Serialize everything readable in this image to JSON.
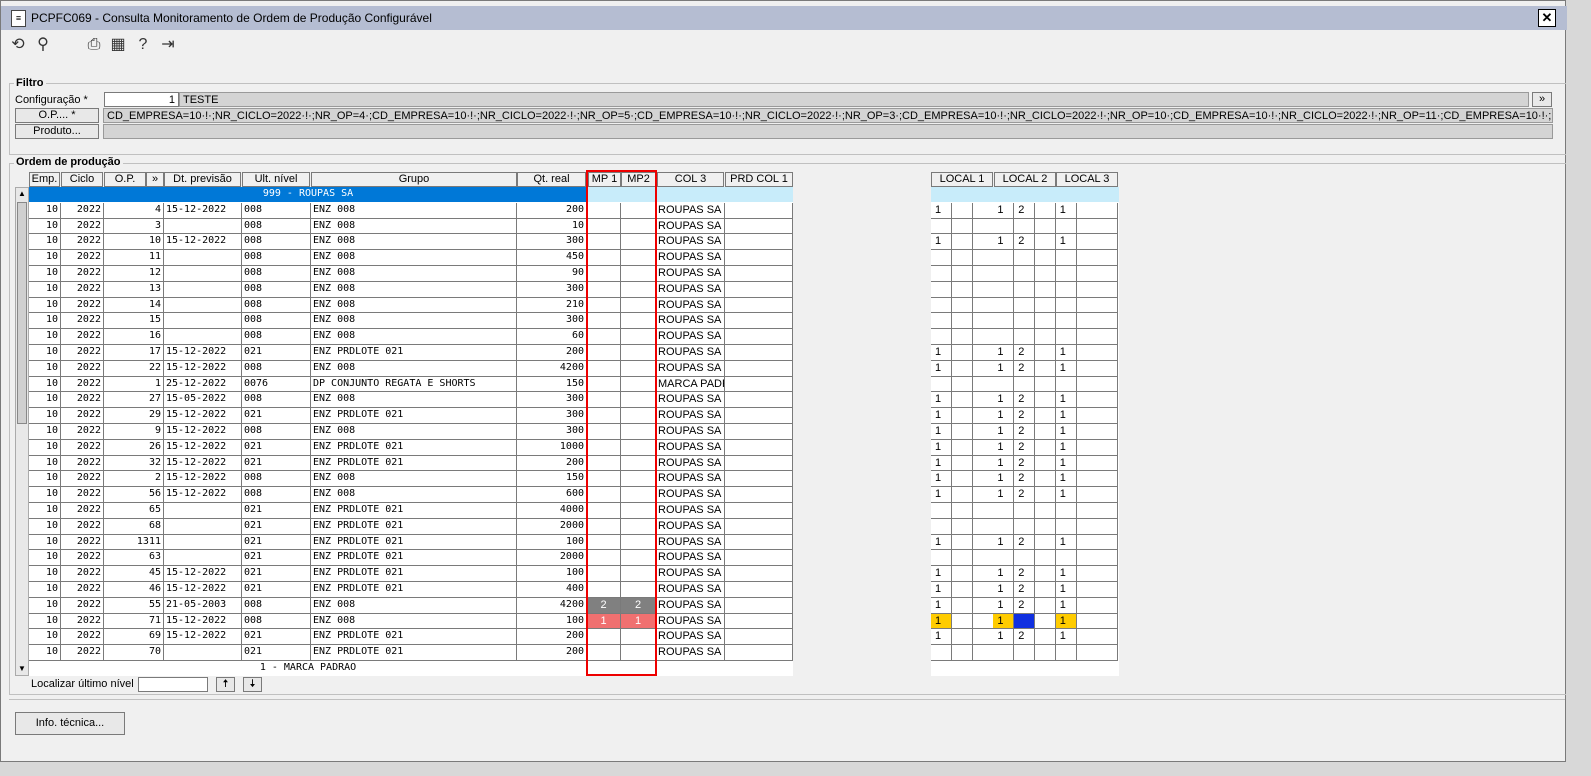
{
  "window": {
    "title": "PCPFC069 - Consulta Monitoramento de Ordem de Produção Configurável",
    "close": "✕"
  },
  "toolbar": [
    {
      "name": "refresh-icon",
      "glyph": "⟲"
    },
    {
      "name": "search-icon",
      "glyph": "⚲"
    },
    {
      "name": "print-icon",
      "glyph": "⎙"
    },
    {
      "name": "calendar-icon",
      "glyph": "▦"
    },
    {
      "name": "help-icon",
      "glyph": "?"
    },
    {
      "name": "exit-icon",
      "glyph": "⇥"
    }
  ],
  "filtro": {
    "legend": "Filtro",
    "config_label": "Configuração *",
    "config_code": "1",
    "config_name": "TESTE",
    "expand": "»",
    "op_button": "O.P.... *",
    "op_value": "CD_EMPRESA=10·!·;NR_CICLO=2022·!·;NR_OP=4·;CD_EMPRESA=10·!·;NR_CICLO=2022·!·;NR_OP=5·;CD_EMPRESA=10·!·;NR_CICLO=2022·!·;NR_OP=3·;CD_EMPRESA=10·!·;NR_CICLO=2022·!·;NR_OP=10·;CD_EMPRESA=10·!·;NR_CICLO=2022·!·;NR_OP=11·;CD_EMPRESA=10·!·;NR_CICLO=2022·!·;NR_OP=",
    "produto_button": "Produto..."
  },
  "ordem": {
    "legend": "Ordem de produção",
    "columns": [
      "Emp.",
      "Ciclo",
      "O.P.",
      "»",
      "Dt. previsão",
      "Ult. nível",
      "Grupo",
      "Qt. real",
      "MP 1",
      "MP2",
      "COL 3",
      "PRD COL 1"
    ],
    "local_columns": [
      "LOCAL 1",
      "LOCAL 2",
      "LOCAL 3"
    ],
    "group_header": "999 - ROUPAS SA",
    "group_footer": "1 - MARCA PADRAO",
    "rows": [
      {
        "emp": "10",
        "ciclo": "2022",
        "op": "4",
        "dt": "15-12-2022",
        "nivel": "008",
        "grupo": "ENZ 008",
        "qt": "200",
        "mp1": "",
        "mp2": "",
        "col3": "ROUPAS SA",
        "locais": [
          "1",
          "",
          "",
          "1",
          "2",
          "",
          "1",
          "",
          ""
        ]
      },
      {
        "emp": "10",
        "ciclo": "2022",
        "op": "3",
        "dt": "",
        "nivel": "008",
        "grupo": "ENZ 008",
        "qt": "10",
        "mp1": "",
        "mp2": "",
        "col3": "ROUPAS SA",
        "locais": [
          "",
          "",
          "",
          "",
          "",
          "",
          "",
          "",
          ""
        ]
      },
      {
        "emp": "10",
        "ciclo": "2022",
        "op": "10",
        "dt": "15-12-2022",
        "nivel": "008",
        "grupo": "ENZ 008",
        "qt": "300",
        "mp1": "",
        "mp2": "",
        "col3": "ROUPAS SA",
        "locais": [
          "1",
          "",
          "",
          "1",
          "2",
          "",
          "1",
          "",
          ""
        ]
      },
      {
        "emp": "10",
        "ciclo": "2022",
        "op": "11",
        "dt": "",
        "nivel": "008",
        "grupo": "ENZ 008",
        "qt": "450",
        "mp1": "",
        "mp2": "",
        "col3": "ROUPAS SA",
        "locais": [
          "",
          "",
          "",
          "",
          "",
          "",
          "",
          "",
          ""
        ]
      },
      {
        "emp": "10",
        "ciclo": "2022",
        "op": "12",
        "dt": "",
        "nivel": "008",
        "grupo": "ENZ 008",
        "qt": "90",
        "mp1": "",
        "mp2": "",
        "col3": "ROUPAS SA",
        "locais": [
          "",
          "",
          "",
          "",
          "",
          "",
          "",
          "",
          ""
        ]
      },
      {
        "emp": "10",
        "ciclo": "2022",
        "op": "13",
        "dt": "",
        "nivel": "008",
        "grupo": "ENZ 008",
        "qt": "300",
        "mp1": "",
        "mp2": "",
        "col3": "ROUPAS SA",
        "locais": [
          "",
          "",
          "",
          "",
          "",
          "",
          "",
          "",
          ""
        ]
      },
      {
        "emp": "10",
        "ciclo": "2022",
        "op": "14",
        "dt": "",
        "nivel": "008",
        "grupo": "ENZ 008",
        "qt": "210",
        "mp1": "",
        "mp2": "",
        "col3": "ROUPAS SA",
        "locais": [
          "",
          "",
          "",
          "",
          "",
          "",
          "",
          "",
          ""
        ]
      },
      {
        "emp": "10",
        "ciclo": "2022",
        "op": "15",
        "dt": "",
        "nivel": "008",
        "grupo": "ENZ 008",
        "qt": "300",
        "mp1": "",
        "mp2": "",
        "col3": "ROUPAS SA",
        "locais": [
          "",
          "",
          "",
          "",
          "",
          "",
          "",
          "",
          ""
        ]
      },
      {
        "emp": "10",
        "ciclo": "2022",
        "op": "16",
        "dt": "",
        "nivel": "008",
        "grupo": "ENZ 008",
        "qt": "60",
        "mp1": "",
        "mp2": "",
        "col3": "ROUPAS SA",
        "locais": [
          "",
          "",
          "",
          "",
          "",
          "",
          "",
          "",
          ""
        ]
      },
      {
        "emp": "10",
        "ciclo": "2022",
        "op": "17",
        "dt": "15-12-2022",
        "nivel": "021",
        "grupo": "ENZ PRDLOTE 021",
        "qt": "200",
        "mp1": "",
        "mp2": "",
        "col3": "ROUPAS SA",
        "locais": [
          "1",
          "",
          "",
          "1",
          "2",
          "",
          "1",
          "",
          ""
        ]
      },
      {
        "emp": "10",
        "ciclo": "2022",
        "op": "22",
        "dt": "15-12-2022",
        "nivel": "008",
        "grupo": "ENZ 008",
        "qt": "4200",
        "mp1": "",
        "mp2": "",
        "col3": "ROUPAS SA",
        "locais": [
          "1",
          "",
          "",
          "1",
          "2",
          "",
          "1",
          "",
          ""
        ]
      },
      {
        "emp": "10",
        "ciclo": "2022",
        "op": "1",
        "dt": "25-12-2022",
        "nivel": "0076",
        "grupo": "DP CONJUNTO REGATA E SHORTS",
        "qt": "150",
        "mp1": "",
        "mp2": "",
        "col3": "MARCA PADR",
        "locais": [
          "",
          "",
          "",
          "",
          "",
          "",
          "",
          "",
          ""
        ]
      },
      {
        "emp": "10",
        "ciclo": "2022",
        "op": "27",
        "dt": "15-05-2022",
        "nivel": "008",
        "grupo": "ENZ 008",
        "qt": "300",
        "mp1": "",
        "mp2": "",
        "col3": "ROUPAS SA",
        "locais": [
          "1",
          "",
          "",
          "1",
          "2",
          "",
          "1",
          "",
          ""
        ]
      },
      {
        "emp": "10",
        "ciclo": "2022",
        "op": "29",
        "dt": "15-12-2022",
        "nivel": "021",
        "grupo": "ENZ PRDLOTE 021",
        "qt": "300",
        "mp1": "",
        "mp2": "",
        "col3": "ROUPAS SA",
        "locais": [
          "1",
          "",
          "",
          "1",
          "2",
          "",
          "1",
          "",
          ""
        ]
      },
      {
        "emp": "10",
        "ciclo": "2022",
        "op": "9",
        "dt": "15-12-2022",
        "nivel": "008",
        "grupo": "ENZ 008",
        "qt": "300",
        "mp1": "",
        "mp2": "",
        "col3": "ROUPAS SA",
        "locais": [
          "1",
          "",
          "",
          "1",
          "2",
          "",
          "1",
          "",
          ""
        ]
      },
      {
        "emp": "10",
        "ciclo": "2022",
        "op": "26",
        "dt": "15-12-2022",
        "nivel": "021",
        "grupo": "ENZ PRDLOTE 021",
        "qt": "1000",
        "mp1": "",
        "mp2": "",
        "col3": "ROUPAS SA",
        "locais": [
          "1",
          "",
          "",
          "1",
          "2",
          "",
          "1",
          "",
          ""
        ]
      },
      {
        "emp": "10",
        "ciclo": "2022",
        "op": "32",
        "dt": "15-12-2022",
        "nivel": "021",
        "grupo": "ENZ PRDLOTE 021",
        "qt": "200",
        "mp1": "",
        "mp2": "",
        "col3": "ROUPAS SA",
        "locais": [
          "1",
          "",
          "",
          "1",
          "2",
          "",
          "1",
          "",
          ""
        ]
      },
      {
        "emp": "10",
        "ciclo": "2022",
        "op": "2",
        "dt": "15-12-2022",
        "nivel": "008",
        "grupo": "ENZ 008",
        "qt": "150",
        "mp1": "",
        "mp2": "",
        "col3": "ROUPAS SA",
        "locais": [
          "1",
          "",
          "",
          "1",
          "2",
          "",
          "1",
          "",
          ""
        ]
      },
      {
        "emp": "10",
        "ciclo": "2022",
        "op": "56",
        "dt": "15-12-2022",
        "nivel": "008",
        "grupo": "ENZ 008",
        "qt": "600",
        "mp1": "",
        "mp2": "",
        "col3": "ROUPAS SA",
        "locais": [
          "1",
          "",
          "",
          "1",
          "2",
          "",
          "1",
          "",
          ""
        ]
      },
      {
        "emp": "10",
        "ciclo": "2022",
        "op": "65",
        "dt": "",
        "nivel": "021",
        "grupo": "ENZ PRDLOTE 021",
        "qt": "4000",
        "mp1": "",
        "mp2": "",
        "col3": "ROUPAS SA",
        "locais": [
          "",
          "",
          "",
          "",
          "",
          "",
          "",
          "",
          ""
        ]
      },
      {
        "emp": "10",
        "ciclo": "2022",
        "op": "68",
        "dt": "",
        "nivel": "021",
        "grupo": "ENZ PRDLOTE 021",
        "qt": "2000",
        "mp1": "",
        "mp2": "",
        "col3": "ROUPAS SA",
        "locais": [
          "",
          "",
          "",
          "",
          "",
          "",
          "",
          "",
          ""
        ]
      },
      {
        "emp": "10",
        "ciclo": "2022",
        "op": "1311",
        "dt": "",
        "nivel": "021",
        "grupo": "ENZ PRDLOTE 021",
        "qt": "100",
        "mp1": "",
        "mp2": "",
        "col3": "ROUPAS SA",
        "locais": [
          "1",
          "",
          "",
          "1",
          "2",
          "",
          "1",
          "",
          ""
        ]
      },
      {
        "emp": "10",
        "ciclo": "2022",
        "op": "63",
        "dt": "",
        "nivel": "021",
        "grupo": "ENZ PRDLOTE 021",
        "qt": "2000",
        "mp1": "",
        "mp2": "",
        "col3": "ROUPAS SA",
        "locais": [
          "",
          "",
          "",
          "",
          "",
          "",
          "",
          "",
          ""
        ]
      },
      {
        "emp": "10",
        "ciclo": "2022",
        "op": "45",
        "dt": "15-12-2022",
        "nivel": "021",
        "grupo": "ENZ PRDLOTE 021",
        "qt": "100",
        "mp1": "",
        "mp2": "",
        "col3": "ROUPAS SA",
        "locais": [
          "1",
          "",
          "",
          "1",
          "2",
          "",
          "1",
          "",
          ""
        ]
      },
      {
        "emp": "10",
        "ciclo": "2022",
        "op": "46",
        "dt": "15-12-2022",
        "nivel": "021",
        "grupo": "ENZ PRDLOTE 021",
        "qt": "400",
        "mp1": "",
        "mp2": "",
        "col3": "ROUPAS SA",
        "locais": [
          "1",
          "",
          "",
          "1",
          "2",
          "",
          "1",
          "",
          ""
        ]
      },
      {
        "emp": "10",
        "ciclo": "2022",
        "op": "55",
        "dt": "21-05-2003",
        "nivel": "008",
        "grupo": "ENZ 008",
        "qt": "4200",
        "mp1": "2",
        "mp2": "2",
        "mpstyle": "gray",
        "col3": "ROUPAS SA",
        "locais": [
          "1",
          "",
          "",
          "1",
          "2",
          "",
          "1",
          "",
          ""
        ]
      },
      {
        "emp": "10",
        "ciclo": "2022",
        "op": "71",
        "dt": "15-12-2022",
        "nivel": "008",
        "grupo": "ENZ 008",
        "qt": "100",
        "mp1": "1",
        "mp2": "1",
        "mpstyle": "red",
        "col3": "ROUPAS SA",
        "locais": [
          "1",
          "",
          "",
          "1",
          "2",
          "",
          "1",
          "",
          ""
        ],
        "localstyle": "highlight"
      },
      {
        "emp": "10",
        "ciclo": "2022",
        "op": "69",
        "dt": "15-12-2022",
        "nivel": "021",
        "grupo": "ENZ PRDLOTE 021",
        "qt": "200",
        "mp1": "",
        "mp2": "",
        "col3": "ROUPAS SA",
        "locais": [
          "1",
          "",
          "",
          "1",
          "2",
          "",
          "1",
          "",
          ""
        ]
      },
      {
        "emp": "10",
        "ciclo": "2022",
        "op": "70",
        "dt": "",
        "nivel": "021",
        "grupo": "ENZ PRDLOTE 021",
        "qt": "200",
        "mp1": "",
        "mp2": "",
        "col3": "ROUPAS SA",
        "locais": [
          "",
          "",
          "",
          "",
          "",
          "",
          "",
          "",
          ""
        ]
      }
    ]
  },
  "localizar": {
    "label": "Localizar último nível",
    "value": "",
    "up": "🠅",
    "down": "🠇"
  },
  "info_button": "Info. técnica...",
  "colors": {
    "group_bar": "#0078d7",
    "selected_row": "#c8ecfa",
    "mp_gray": "#808080",
    "mp_red": "#f07070",
    "local_yellow": "#ffcc00",
    "local_blue": "#1030e0",
    "red_box": "#ee0000"
  }
}
